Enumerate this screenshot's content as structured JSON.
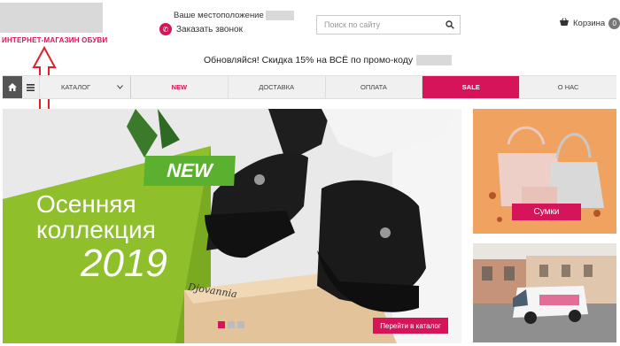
{
  "header": {
    "logo_caption": "ИНТЕРНЕТ-МАГАЗИН ОБУВИ",
    "location_label": "Ваше местоположение",
    "callback_label": "Заказать звонок",
    "search": {
      "placeholder": "Поиск по сайту"
    },
    "cart": {
      "label": "Корзина",
      "count": "0"
    }
  },
  "promo": {
    "text": "Обновляйся! Скидка 15% на ВСЁ по промо-коду"
  },
  "nav": {
    "catalog": "КАТАЛОГ",
    "items": [
      "NEW",
      "ДОСТАВКА",
      "ОПЛАТА",
      "SALE",
      "О НАС"
    ]
  },
  "banner": {
    "new_tag": "NEW",
    "line1": "Осенняя",
    "line2": "коллекция",
    "year": "2019",
    "brand": "Djovannia",
    "cta": "Перейти в каталог"
  },
  "side": {
    "bags_label": "Сумки"
  },
  "colors": {
    "accent": "#d6145a",
    "green": "#5bb12f"
  }
}
